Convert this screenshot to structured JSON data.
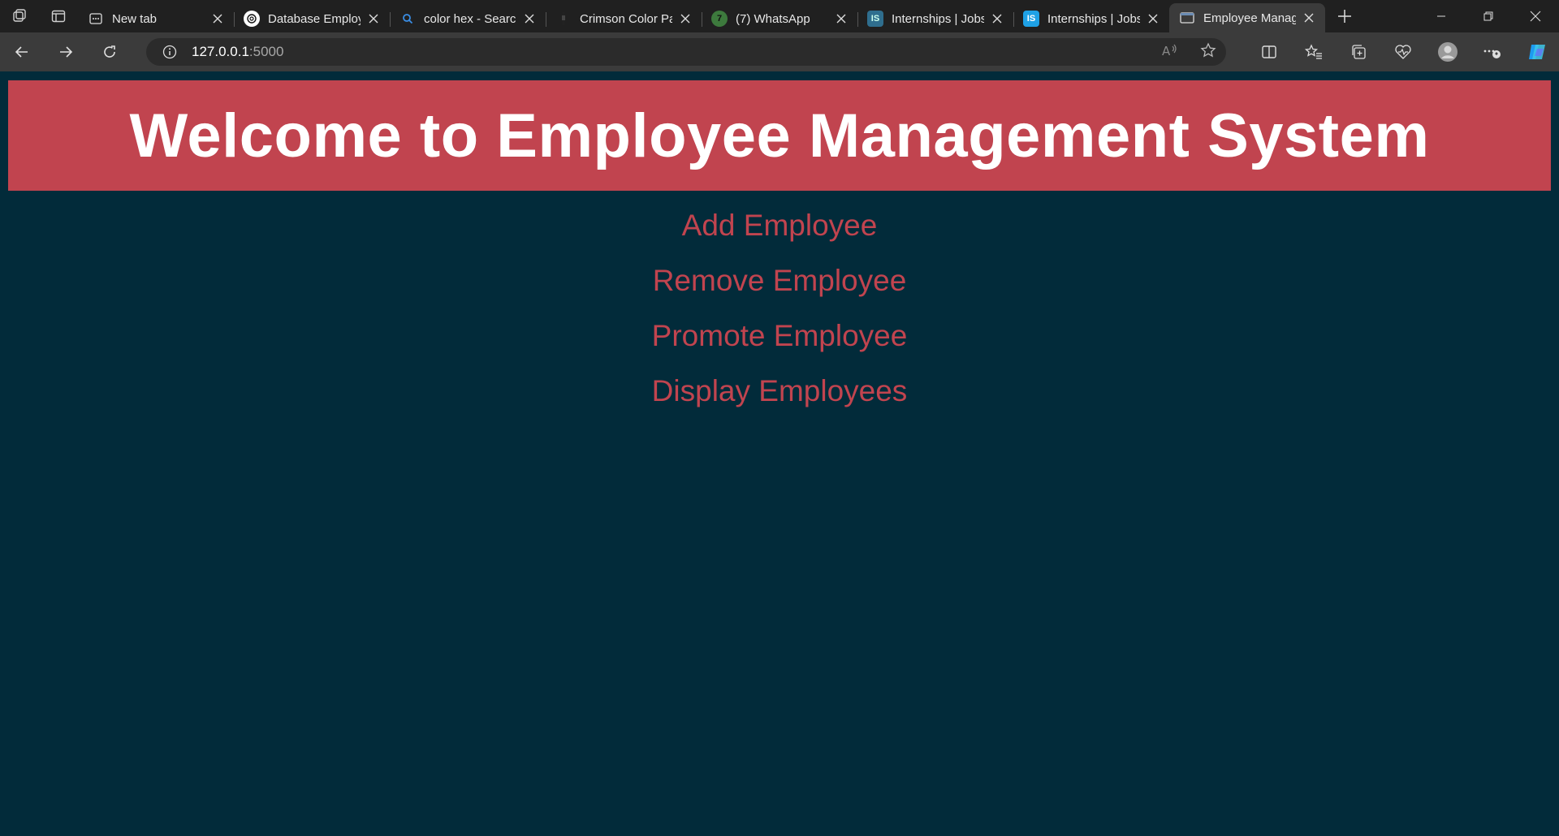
{
  "browser": {
    "tabs": [
      {
        "title": "New tab",
        "favicon": "newtab-icon",
        "active": false
      },
      {
        "title": "Database Employ",
        "favicon": "chatgpt-icon",
        "active": false
      },
      {
        "title": "color hex - Searc",
        "favicon": "search-icon",
        "active": false
      },
      {
        "title": "Crimson Color Pa",
        "favicon": "crimson-icon",
        "active": false
      },
      {
        "title": "(7) WhatsApp",
        "favicon": "whatsapp-icon",
        "active": false
      },
      {
        "title": "Internships | Jobs",
        "favicon": "internshala-icon",
        "active": false
      },
      {
        "title": "Internships | Jobs",
        "favicon": "internshala-icon",
        "active": false
      },
      {
        "title": "Employee Manag",
        "favicon": "page-icon",
        "active": true
      }
    ],
    "address": {
      "host": "127.0.0.1",
      "port": ":5000"
    }
  },
  "page": {
    "title": "Welcome to Employee Management System",
    "menu": [
      {
        "label": "Add Employee"
      },
      {
        "label": "Remove Employee"
      },
      {
        "label": "Promote Employee"
      },
      {
        "label": "Display Employees"
      }
    ]
  },
  "colors": {
    "banner": "#c1444f",
    "background": "#022b3a",
    "link": "#c1444f",
    "title_text": "#ffffff"
  }
}
